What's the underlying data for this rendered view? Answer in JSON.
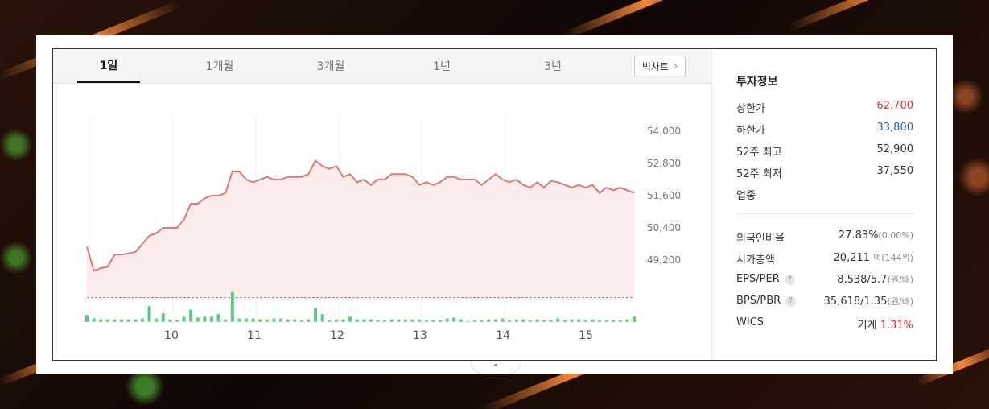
{
  "tabs": [
    {
      "label": "1일",
      "active": true
    },
    {
      "label": "1개월",
      "active": false
    },
    {
      "label": "3개월",
      "active": false
    },
    {
      "label": "1년",
      "active": false
    },
    {
      "label": "3년",
      "active": false
    }
  ],
  "big_chart_label": "빅차트",
  "chart_data": {
    "type": "line",
    "y_ticks": [
      "54,000",
      "52,800",
      "51,600",
      "50,400",
      "49,200"
    ],
    "x_ticks": [
      "10",
      "11",
      "12",
      "13",
      "14",
      "15"
    ],
    "ylim": [
      48000,
      54000
    ],
    "previous_close": 47800,
    "price": [
      49700,
      48800,
      48900,
      48950,
      49400,
      49400,
      49450,
      49500,
      49800,
      50100,
      50200,
      50400,
      50400,
      50400,
      50700,
      51300,
      51300,
      51500,
      51600,
      51600,
      51700,
      52500,
      52500,
      52200,
      52100,
      52200,
      52300,
      52200,
      52200,
      52300,
      52300,
      52300,
      52400,
      52900,
      52700,
      52600,
      52700,
      52300,
      52400,
      52100,
      52200,
      52000,
      52200,
      52200,
      52400,
      52400,
      52400,
      52300,
      52000,
      52100,
      52000,
      52100,
      52300,
      52300,
      52200,
      52200,
      52200,
      52000,
      52200,
      52400,
      52200,
      52100,
      52200,
      52000,
      51900,
      52100,
      51900,
      52150,
      52100,
      52000,
      51900,
      52000,
      51900,
      52000,
      51700,
      51900,
      51800,
      51900,
      51800,
      51700
    ],
    "volume": [
      8,
      4,
      3,
      3,
      3,
      3,
      3,
      3,
      4,
      18,
      4,
      10,
      3,
      2,
      6,
      14,
      5,
      6,
      6,
      9,
      3,
      34,
      4,
      4,
      4,
      3,
      3,
      4,
      4,
      3,
      3,
      2,
      3,
      16,
      9,
      2,
      3,
      3,
      6,
      3,
      3,
      3,
      2,
      2,
      3,
      3,
      3,
      3,
      3,
      2,
      2,
      2,
      4,
      5,
      3,
      1,
      2,
      2,
      3,
      3,
      4,
      2,
      3,
      3,
      2,
      3,
      2,
      2,
      4,
      2,
      3,
      3,
      2,
      3,
      2,
      2,
      2,
      2,
      3,
      6
    ],
    "colors": {
      "line": "#d97b73",
      "fill": "#fdecec",
      "volume": "#5cc880",
      "baseline": "#888888"
    }
  },
  "info": {
    "title": "투자정보",
    "upper_limit_label": "상한가",
    "upper_limit_value": "62,700",
    "lower_limit_label": "하한가",
    "lower_limit_value": "33,800",
    "week52_high_label": "52주 최고",
    "week52_high_value": "52,900",
    "week52_low_label": "52주 최저",
    "week52_low_value": "37,550",
    "industry_label": "업종",
    "foreign_ratio_label": "외국인비율",
    "foreign_ratio_value": "27.83%",
    "foreign_ratio_sub": "(0.00%)",
    "market_cap_label": "시가총액",
    "market_cap_value": "20,211",
    "market_cap_unit": "억",
    "market_cap_sub": "(144위)",
    "eps_per_label": "EPS/PER",
    "eps_per_value": "8,538/5.7",
    "eps_per_sub": "(원/배)",
    "bps_pbr_label": "BPS/PBR",
    "bps_pbr_value": "35,618/1.35",
    "bps_pbr_sub": "(원/배)",
    "wics_label": "WICS",
    "wics_value": "기계",
    "wics_change": "1.31%",
    "help_glyph": "?"
  },
  "toggle_glyph": "⌃"
}
